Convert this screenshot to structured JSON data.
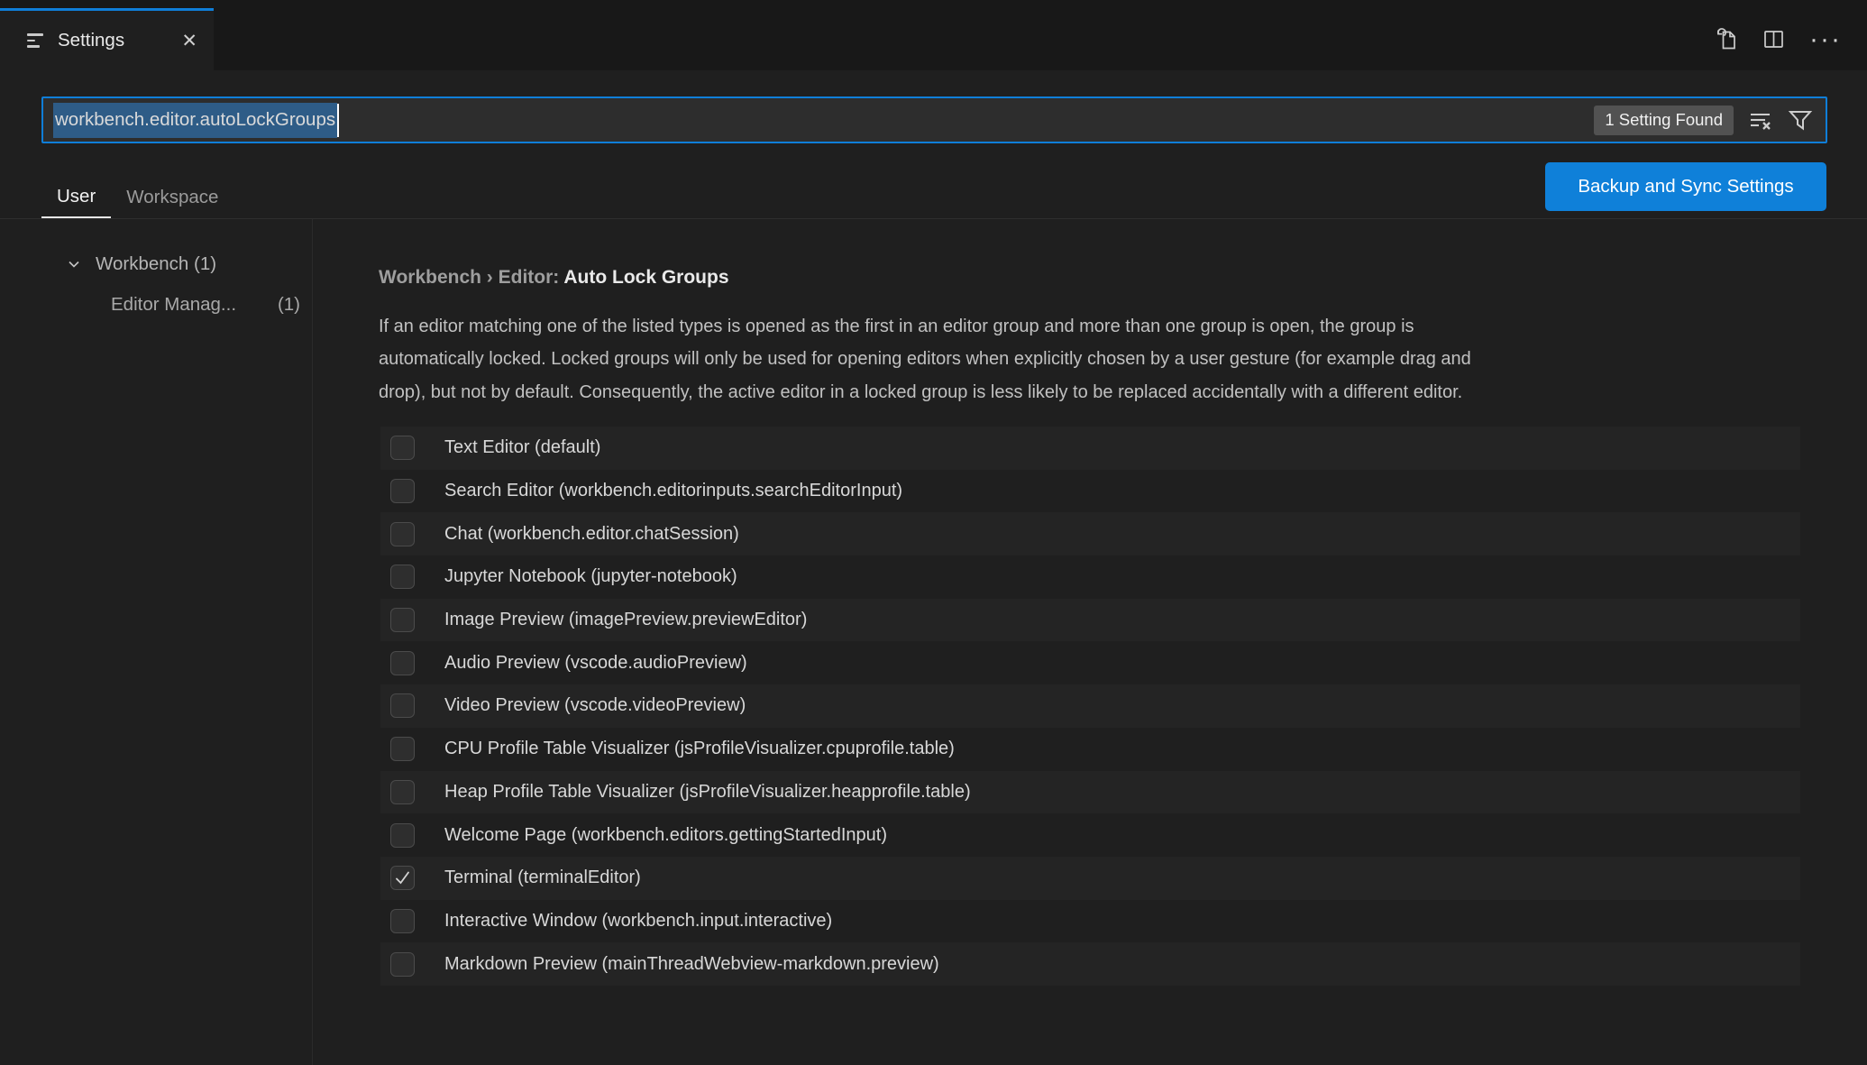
{
  "window": {
    "tab_title": "Settings"
  },
  "toolbar": {
    "more_actions_glyph": "···"
  },
  "search": {
    "value": "workbench.editor.autoLockGroups",
    "badge": "1 Setting Found"
  },
  "scope_tabs": {
    "user": "User",
    "workspace": "Workspace",
    "active": "User"
  },
  "sync_button_label": "Backup and Sync Settings",
  "toc": {
    "root_label": "Workbench",
    "root_count": "(1)",
    "child_label": "Editor Manag...",
    "child_count": "(1)"
  },
  "setting": {
    "breadcrumb": "Workbench › Editor: ",
    "title": "Auto Lock Groups",
    "description_lines": [
      "If an editor matching one of the listed types is opened as the first in an editor group and more than one group is open, the group is",
      "automatically locked. Locked groups will only be used for opening editors when explicitly chosen by a user gesture (for example drag and",
      "drop), but not by default. Consequently, the active editor in a locked group is less likely to be replaced accidentally with a different editor."
    ],
    "options": [
      {
        "label": "Text Editor (default)",
        "checked": false
      },
      {
        "label": "Search Editor (workbench.editorinputs.searchEditorInput)",
        "checked": false
      },
      {
        "label": "Chat (workbench.editor.chatSession)",
        "checked": false
      },
      {
        "label": "Jupyter Notebook (jupyter-notebook)",
        "checked": false
      },
      {
        "label": "Image Preview (imagePreview.previewEditor)",
        "checked": false
      },
      {
        "label": "Audio Preview (vscode.audioPreview)",
        "checked": false
      },
      {
        "label": "Video Preview (vscode.videoPreview)",
        "checked": false
      },
      {
        "label": "CPU Profile Table Visualizer (jsProfileVisualizer.cpuprofile.table)",
        "checked": false
      },
      {
        "label": "Heap Profile Table Visualizer (jsProfileVisualizer.heapprofile.table)",
        "checked": false
      },
      {
        "label": "Welcome Page (workbench.editors.gettingStartedInput)",
        "checked": false
      },
      {
        "label": "Terminal (terminalEditor)",
        "checked": true
      },
      {
        "label": "Interactive Window (workbench.input.interactive)",
        "checked": false
      },
      {
        "label": "Markdown Preview (mainThreadWebview-markdown.preview)",
        "checked": false
      }
    ]
  },
  "colors": {
    "accent": "#0f7ed8",
    "button": "#0f80d9",
    "selection": "#2e5c87",
    "row_alt": "#242424",
    "background": "#1f1f1f",
    "tabbar": "#181818"
  }
}
